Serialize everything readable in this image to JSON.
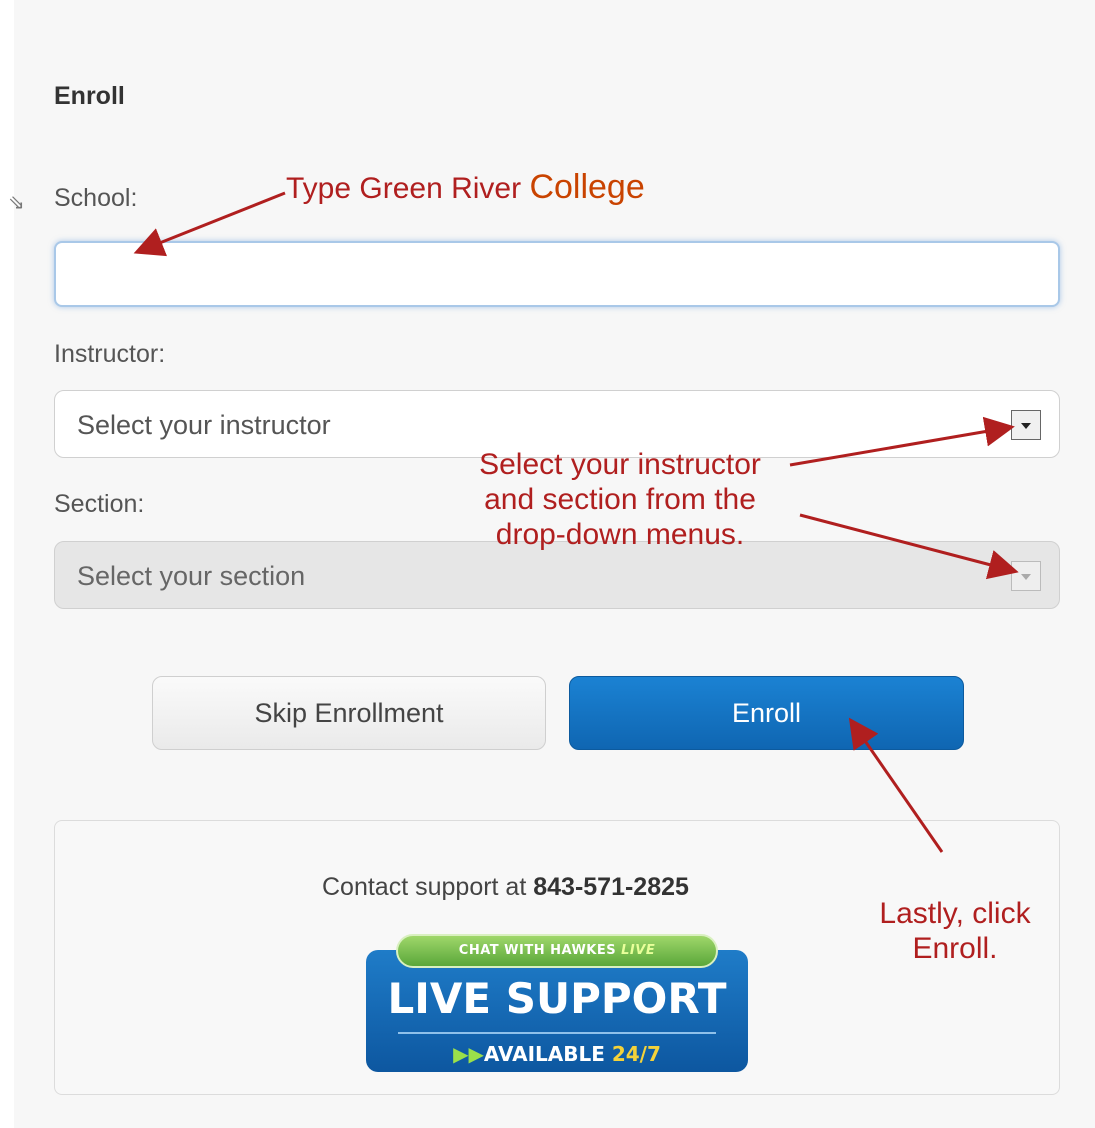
{
  "form": {
    "heading": "Enroll",
    "school": {
      "label": "School:",
      "value": "",
      "placeholder": ""
    },
    "instructor": {
      "label": "Instructor:",
      "selected": "Select your instructor",
      "enabled": true
    },
    "section": {
      "label": "Section:",
      "selected": "Select your section",
      "enabled": false
    },
    "buttons": {
      "skip_label": "Skip Enrollment",
      "enroll_label": "Enroll"
    }
  },
  "support": {
    "prefix": "Contact support at ",
    "phone": "843-571-2825",
    "badge": {
      "chat_text": "CHAT WITH HAWKES ",
      "chat_live": "LIVE",
      "title": "LIVE SUPPORT",
      "avail_arrows": "▶▶",
      "avail_text": "AVAILABLE ",
      "avail_hours": "24/7"
    }
  },
  "annotations": {
    "school_part1": "Type Green River ",
    "school_part2": "College",
    "dropdowns_line1": "Select your instructor",
    "dropdowns_line2": "and section from the",
    "dropdowns_line3": "drop-down menus.",
    "enroll_line1": "Lastly, click",
    "enroll_line2": "Enroll."
  },
  "colors": {
    "annotation_red": "#b01f1f",
    "annotation_orange": "#c94300",
    "enroll_blue": "#1472c2",
    "badge_green": "#6cbf43"
  },
  "icons": {
    "cursor": "mouse-cursor-icon",
    "dropdown": "chevron-down-icon"
  }
}
